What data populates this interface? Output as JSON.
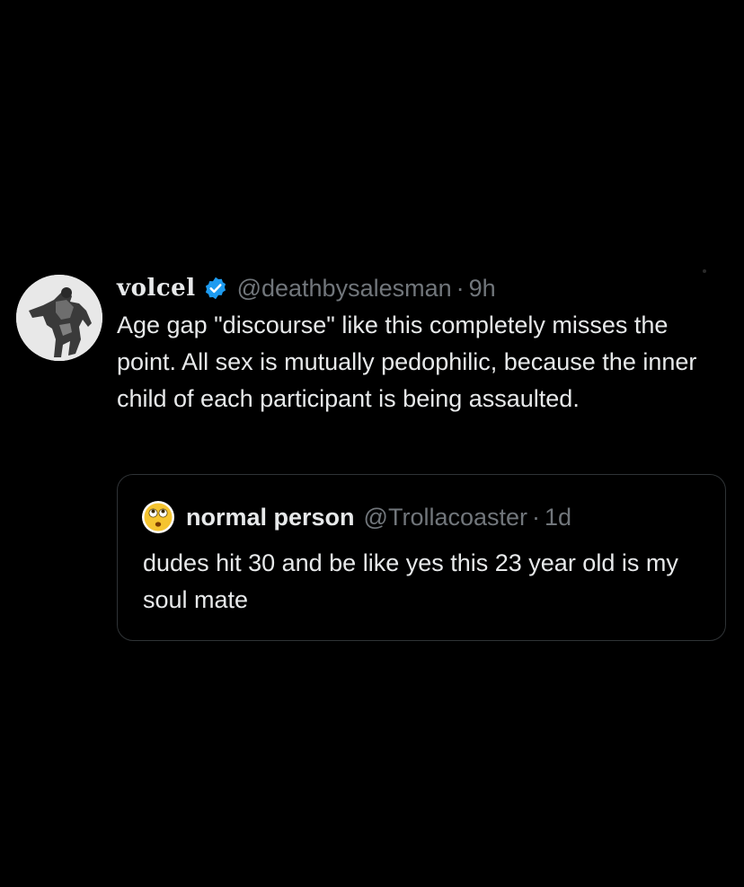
{
  "tweet": {
    "display_name": "volcel",
    "handle": "@deathbysalesman",
    "separator": "·",
    "time": "9h",
    "text": "Age gap \"discourse\" like this completely misses the point. All sex is mutually pedophilic, because the inner child of each participant is being assaulted.",
    "verified_color": "#1d9bf0"
  },
  "quote": {
    "display_name": "normal person",
    "handle": "@Trollacoaster",
    "separator": "·",
    "time": "1d",
    "text": "dudes hit 30 and be like yes this 23 year old is my soul mate"
  },
  "colors": {
    "background": "#000000",
    "primary_text": "#e7e9ea",
    "secondary_text": "#71767b",
    "border": "#2f3336"
  }
}
